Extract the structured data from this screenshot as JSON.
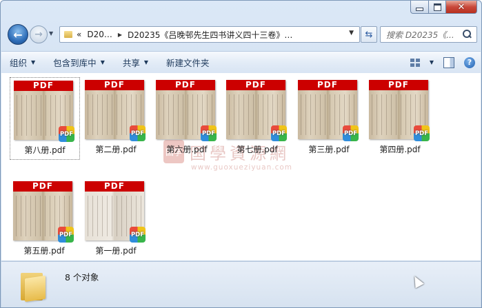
{
  "window": {
    "minimize_glyph": "",
    "close_glyph": "✕"
  },
  "nav": {
    "back_glyph": "←",
    "forward_glyph": "→",
    "history_glyph": "▼",
    "breadcrumb_lead": "«",
    "breadcrumb": [
      "D20…",
      "D20235《吕晚邨先生四书讲义四十三卷》…"
    ],
    "refresh_glyph": "⇆",
    "search_placeholder": "搜索 D20235《..."
  },
  "toolbar": {
    "organize": "组织",
    "include_in_library": "包含到库中",
    "share": "共享",
    "new_folder": "新建文件夹",
    "help": "?"
  },
  "files": [
    {
      "name": "第八册.pdf",
      "selected": true
    },
    {
      "name": "第二册.pdf"
    },
    {
      "name": "第六册.pdf"
    },
    {
      "name": "第七册.pdf"
    },
    {
      "name": "第三册.pdf"
    },
    {
      "name": "第四册.pdf"
    },
    {
      "name": "第五册.pdf"
    },
    {
      "name": "第一册.pdf",
      "light": true
    }
  ],
  "thumbnail": {
    "banner": "PDF",
    "badge": "PDF"
  },
  "watermark": {
    "seal": "国学",
    "title": "国學資源網",
    "url": "www.guoxueziyuan.com"
  },
  "status": {
    "count_text": "8 个对象"
  }
}
